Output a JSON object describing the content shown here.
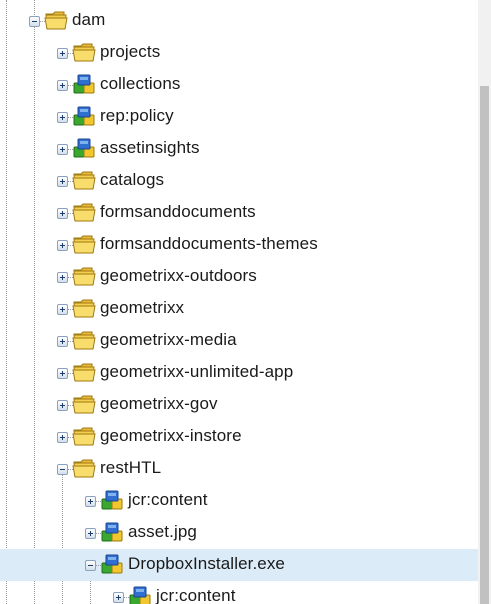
{
  "tree": {
    "nodes": [
      {
        "label": "dam",
        "depth": 0,
        "icon": "folder-icon",
        "expanded": true,
        "selected": false
      },
      {
        "label": "projects",
        "depth": 1,
        "icon": "folder-icon",
        "expanded": false,
        "selected": false
      },
      {
        "label": "collections",
        "depth": 1,
        "icon": "node-icon",
        "expanded": false,
        "selected": false
      },
      {
        "label": "rep:policy",
        "depth": 1,
        "icon": "node-icon",
        "expanded": false,
        "selected": false
      },
      {
        "label": "assetinsights",
        "depth": 1,
        "icon": "node-icon",
        "expanded": false,
        "selected": false
      },
      {
        "label": "catalogs",
        "depth": 1,
        "icon": "folder-icon",
        "expanded": false,
        "selected": false
      },
      {
        "label": "formsanddocuments",
        "depth": 1,
        "icon": "folder-icon",
        "expanded": false,
        "selected": false
      },
      {
        "label": "formsanddocuments-themes",
        "depth": 1,
        "icon": "folder-icon",
        "expanded": false,
        "selected": false
      },
      {
        "label": "geometrixx-outdoors",
        "depth": 1,
        "icon": "folder-icon",
        "expanded": false,
        "selected": false
      },
      {
        "label": "geometrixx",
        "depth": 1,
        "icon": "folder-icon",
        "expanded": false,
        "selected": false
      },
      {
        "label": "geometrixx-media",
        "depth": 1,
        "icon": "folder-icon",
        "expanded": false,
        "selected": false
      },
      {
        "label": "geometrixx-unlimited-app",
        "depth": 1,
        "icon": "folder-icon",
        "expanded": false,
        "selected": false
      },
      {
        "label": "geometrixx-gov",
        "depth": 1,
        "icon": "folder-icon",
        "expanded": false,
        "selected": false
      },
      {
        "label": "geometrixx-instore",
        "depth": 1,
        "icon": "folder-icon",
        "expanded": false,
        "selected": false
      },
      {
        "label": "restHTL",
        "depth": 1,
        "icon": "folder-icon",
        "expanded": true,
        "selected": false
      },
      {
        "label": "jcr:content",
        "depth": 2,
        "icon": "node-icon",
        "expanded": false,
        "selected": false
      },
      {
        "label": "asset.jpg",
        "depth": 2,
        "icon": "node-icon",
        "expanded": false,
        "selected": false
      },
      {
        "label": "DropboxInstaller.exe",
        "depth": 2,
        "icon": "node-icon",
        "expanded": true,
        "selected": true
      },
      {
        "label": "jcr:content",
        "depth": 3,
        "icon": "node-icon",
        "expanded": false,
        "selected": false
      }
    ]
  },
  "colors": {
    "selection_bg": "#dcebf8",
    "folder_yellow": "#f3cf4e",
    "node_blue": "#2f6fd0",
    "node_green": "#3aa82f",
    "node_yellow": "#f2c62e"
  }
}
